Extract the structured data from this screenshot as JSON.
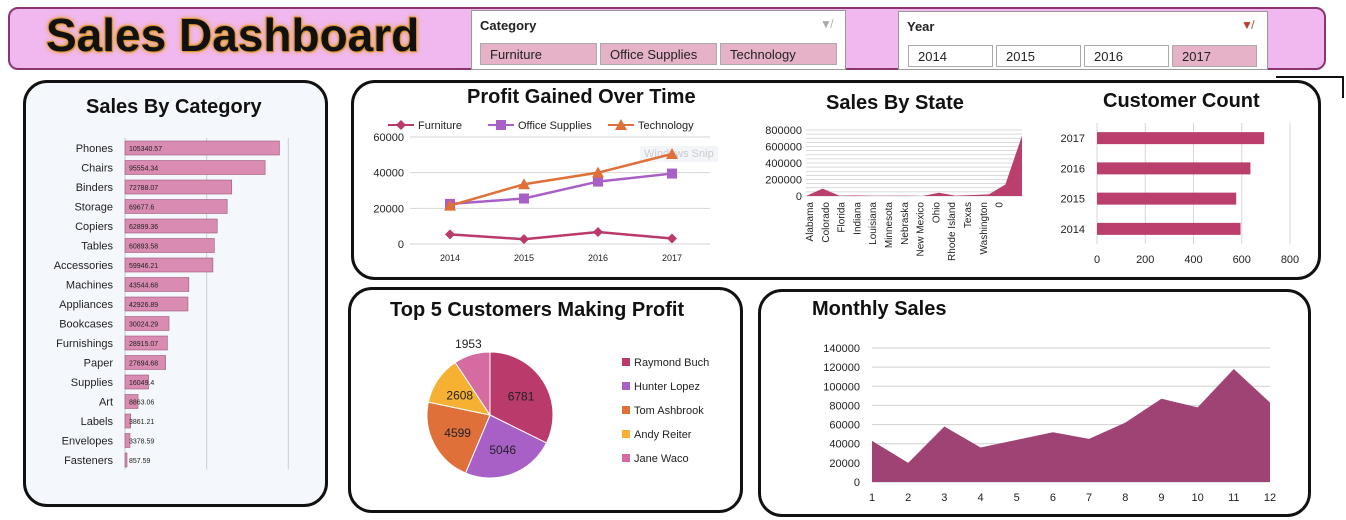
{
  "header": {
    "title": "Sales Dashboard"
  },
  "slicers": {
    "category": {
      "title": "Category",
      "items": [
        "Furniture",
        "Office Supplies",
        "Technology"
      ],
      "selected": [
        "Furniture",
        "Office Supplies",
        "Technology"
      ]
    },
    "year": {
      "title": "Year",
      "items": [
        "2014",
        "2015",
        "2016",
        "2017"
      ],
      "selected": [
        "2017"
      ]
    }
  },
  "watermark": "Windows Snip",
  "colors": {
    "furniture": "#b93a6b",
    "office_supplies": "#a960c6",
    "technology": "#e0703a",
    "sales_bar": "#d98bb1",
    "customer_bar": "#bb3f6c",
    "area": "#9e4373",
    "banner": "#f0b8ee"
  },
  "chart_data": [
    {
      "id": "sales-by-category",
      "type": "bar",
      "orientation": "horizontal",
      "title": "Sales By Category",
      "categories": [
        "Phones",
        "Chairs",
        "Binders",
        "Storage",
        "Copiers",
        "Tables",
        "Accessories",
        "Machines",
        "Appliances",
        "Bookcases",
        "Furnishings",
        "Paper",
        "Supplies",
        "Art",
        "Labels",
        "Envelopes",
        "Fasteners"
      ],
      "values": [
        105340.57,
        95554.34,
        72788.07,
        69677.6,
        62899.36,
        60893.58,
        59946.21,
        43544.68,
        42926.89,
        30024.29,
        28915.07,
        27694.68,
        16049.4,
        8863.06,
        3861.21,
        3378.59,
        857.59
      ],
      "labels": [
        "105340.57",
        "95554.34",
        "72788.07",
        "69677.6",
        "62899.36",
        "60893.58",
        "59946.21",
        "43544.68",
        "42926.89",
        "30024.29",
        "28915.07",
        "27694.68",
        "16049.4",
        "8863.06",
        "3861.21",
        "3378.59",
        "857.59"
      ],
      "xlim": [
        0,
        160000
      ],
      "grid": true
    },
    {
      "id": "profit-over-time",
      "type": "line",
      "title": "Profit Gained Over Time",
      "x": [
        "2014",
        "2015",
        "2016",
        "2017"
      ],
      "series": [
        {
          "name": "Furniture",
          "values": [
            5400,
            2700,
            6700,
            3100
          ]
        },
        {
          "name": "Office Supplies",
          "values": [
            22500,
            25500,
            35000,
            39500
          ]
        },
        {
          "name": "Technology",
          "values": [
            21500,
            33500,
            40000,
            50500
          ]
        }
      ],
      "yticks": [
        "0",
        "20000",
        "40000",
        "60000"
      ],
      "ylim": [
        0,
        60000
      ],
      "legend": "top",
      "grid": true
    },
    {
      "id": "sales-by-state",
      "type": "area",
      "title": "Sales By State",
      "categories": [
        "Alabama",
        "Colorado",
        "Florida",
        "Indiana",
        "Louisiana",
        "Minnesota",
        "Nebraska",
        "New Mexico",
        "Ohio",
        "Rhode Island",
        "Texas",
        "Washington",
        "0"
      ],
      "values": [
        0,
        90000,
        5000,
        8000,
        3000,
        3000,
        4000,
        500,
        40000,
        5000,
        12000,
        20000,
        140000,
        730000
      ],
      "yticks": [
        "0",
        "200000",
        "400000",
        "600000",
        "800000"
      ],
      "ylim": [
        0,
        800000
      ],
      "grid": true
    },
    {
      "id": "customer-count",
      "type": "bar",
      "orientation": "horizontal",
      "title": "Customer Count",
      "categories": [
        "2017",
        "2016",
        "2015",
        "2014"
      ],
      "values": [
        693,
        636,
        577,
        595
      ],
      "xticks": [
        "0",
        "200",
        "400",
        "600",
        "800"
      ],
      "xlim": [
        0,
        800
      ],
      "grid": true
    },
    {
      "id": "top-customers",
      "type": "pie",
      "title": "Top 5 Customers Making Profit",
      "labels": [
        "Raymond Buch",
        "Hunter Lopez",
        "Tom Ashbrook",
        "Andy Reiter",
        "Jane Waco"
      ],
      "values": [
        6781,
        5046,
        4599,
        2608,
        1953
      ],
      "legend": "right"
    },
    {
      "id": "monthly-sales",
      "type": "area",
      "title": "Monthly Sales",
      "x": [
        "1",
        "2",
        "3",
        "4",
        "5",
        "6",
        "7",
        "8",
        "9",
        "10",
        "11",
        "12"
      ],
      "values": [
        43000,
        20000,
        58000,
        36000,
        44000,
        52000,
        45000,
        62000,
        87000,
        78000,
        118000,
        83000
      ],
      "yticks": [
        "0",
        "20000",
        "40000",
        "60000",
        "80000",
        "100000",
        "120000",
        "140000"
      ],
      "ylim": [
        0,
        140000
      ],
      "grid": true
    }
  ]
}
